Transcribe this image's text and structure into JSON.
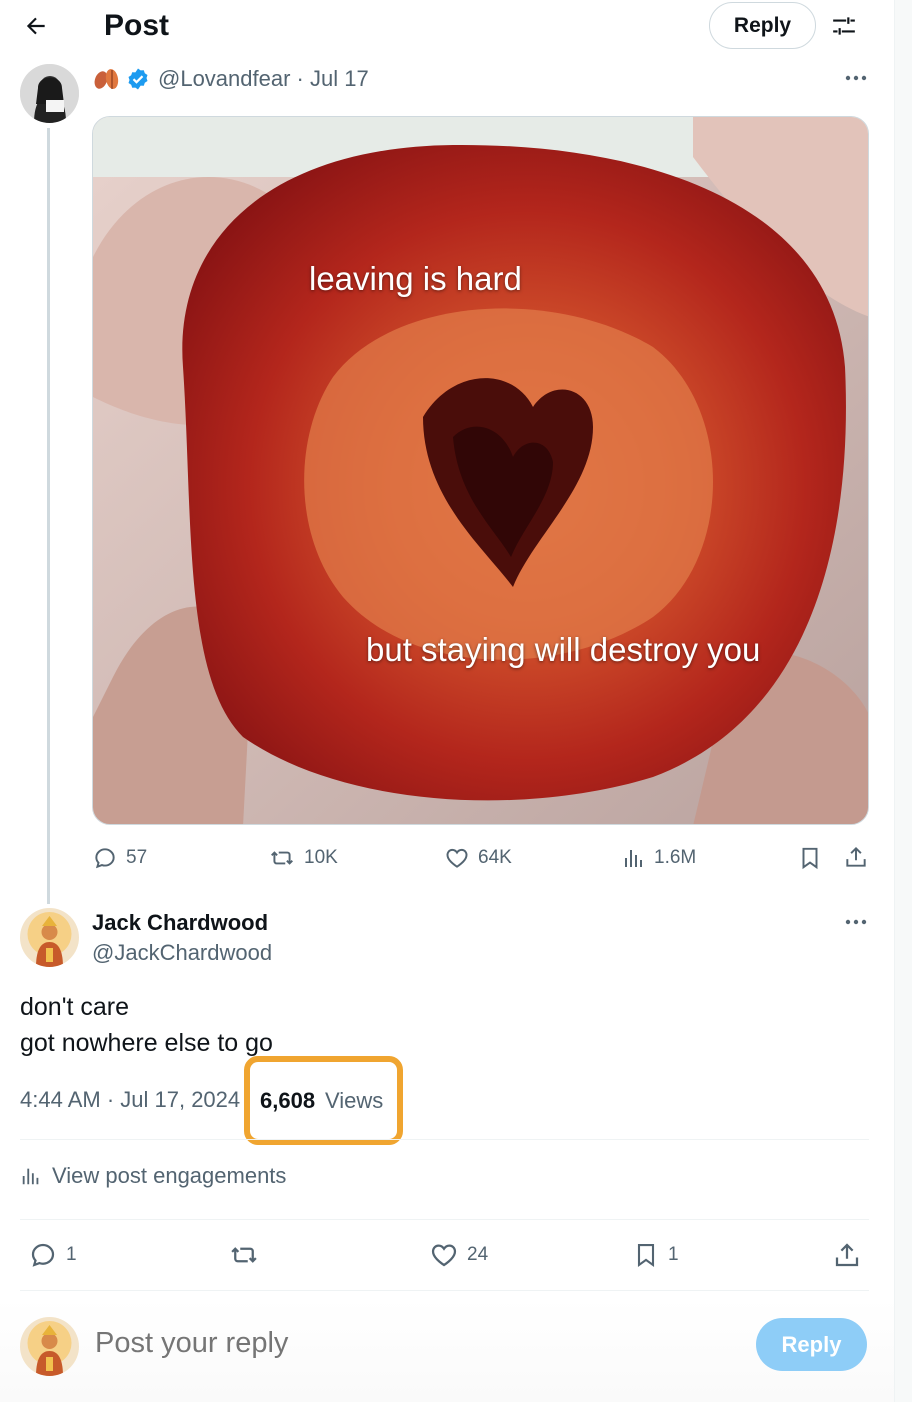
{
  "header": {
    "title": "Post",
    "reply_label": "Reply"
  },
  "original_post": {
    "handle": "@Lovandfear",
    "date": "Jul 17",
    "name_emoji_icon": "leaves-emoji-icon",
    "verified": true,
    "media": {
      "caption_top": "leaving is hard",
      "caption_bottom": "but staying will destroy you"
    },
    "stats": {
      "replies": "57",
      "reposts": "10K",
      "likes": "64K",
      "views": "1.6M"
    }
  },
  "reply_post": {
    "name": "Jack Chardwood",
    "handle": "@JackChardwood",
    "body_lines": [
      "don't care",
      "got nowhere else to go"
    ],
    "timestamp": "4:44 AM · Jul 17, 2024",
    "views_count": "6,608",
    "views_label": "Views",
    "engagements_label": "View post engagements",
    "stats": {
      "replies": "1",
      "reposts": "",
      "likes": "24",
      "bookmarks": "1"
    }
  },
  "composer": {
    "placeholder": "Post your reply",
    "button_label": "Reply"
  },
  "colors": {
    "text": "#0f1419",
    "muted": "#536471",
    "verified": "#1d9bf0",
    "highlight": "#f0a530",
    "reply_button_disabled": "#8ecdf7"
  }
}
